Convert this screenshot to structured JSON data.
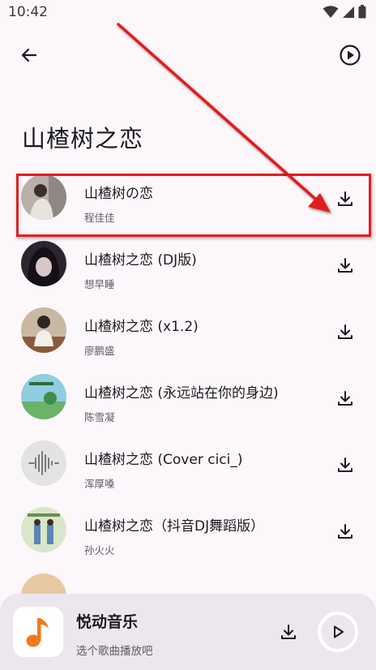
{
  "status_bar": {
    "time": "10:42"
  },
  "app_bar": {
    "back_icon": "arrow-back-icon",
    "play_all_icon": "play-circle-icon"
  },
  "page_title": "山楂树之恋",
  "songs": [
    {
      "title": "山楂树の恋",
      "artist": "程佳佳",
      "cover_color": "#b9b0aa"
    },
    {
      "title": "山楂树之恋 (DJ版)",
      "artist": "想早睡",
      "cover_color": "#2a2530"
    },
    {
      "title": "山楂树之恋 (x1.2)",
      "artist": "廖鹏盛",
      "cover_color": "#c9b9a3"
    },
    {
      "title": "山楂树之恋 (永远站在你的身边)",
      "artist": "陈雪凝",
      "cover_color": "#8fcde0"
    },
    {
      "title": "山楂树之恋 (Cover cici_)",
      "artist": "浑厚嗓",
      "cover_color": "#e3e3e3"
    },
    {
      "title": "山楂树之恋（抖音DJ舞蹈版）",
      "artist": "孙火火",
      "cover_color": "#d9e7c8"
    }
  ],
  "player": {
    "title": "悦动音乐",
    "subtitle": "选个歌曲播放吧",
    "icon_color": "#f27a1a"
  },
  "colors": {
    "highlight": "#e01f1f",
    "background": "#fcf7fb",
    "player_background": "#ece6ee"
  }
}
